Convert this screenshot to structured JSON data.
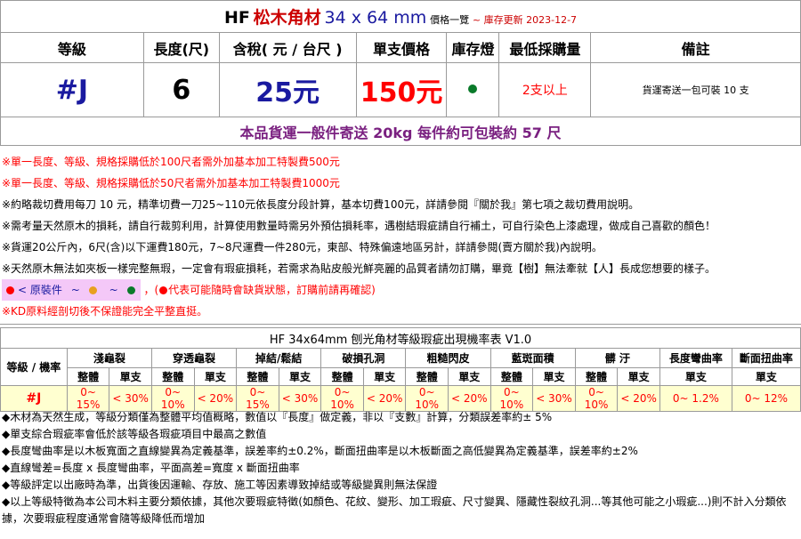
{
  "title": {
    "brand": "HF",
    "material": "松木角材",
    "size": "34 x 64 mm",
    "subtitle": "價格一覽",
    "date_note": "~ 庫存更新 2023-12-7"
  },
  "headers": [
    "等級",
    "長度(尺)",
    "含稅( 元 / 台尺 )",
    "單支價格",
    "庫存燈",
    "最低採購量",
    "備註"
  ],
  "product": {
    "grade": "#J",
    "length": "6",
    "price_per_tai_chi": "25元",
    "unit_price": "150元",
    "stock_light_color": "#0a7a2a",
    "min_order": "2支以上",
    "remark": "貨運寄送一包可裝 10 支"
  },
  "shipping_banner": "本品貨運一般件寄送 20kg 每件約可包裝約 57 尺",
  "notes": {
    "n1": "※單一長度、等級、規格採購低於100尺者需外加基本加工特製費500元",
    "n2": "※單一長度、等級、規格採購低於50尺者需外加基本加工特製費1000元",
    "n3": "※約略裁切費用每刀 10 元，精準切費一刀25~110元依長度分段計算，基本切費100元，詳請參閱『關於我』第七項之裁切費用說明。",
    "n4": "※需考量天然原木的損耗，請自行裁剪利用，計算使用數量時需另外預估損耗率，遇樹結瑕疵請自行補土，可自行染色上漆處理，做成自己喜歡的顏色！",
    "n5": "※貨運20公斤內，6尺(含)以下運費180元，7~8尺運費一件280元，東部、特殊偏遠地區另計，詳請參閱(賣方關於我)內說明。",
    "n6": "※天然原木無法如夾板一樣完整無瑕，一定會有瑕疵損耗，若需求為貼皮般光鮮亮麗的品質者請勿訂購，畢竟【樹】無法牽就【人】長成您想要的樣子。",
    "stock_label": "< 原裝件",
    "stock_colors": [
      "#ff0000",
      "#e8a020",
      "#0a7a2a"
    ],
    "stock_tilde": "~",
    "red_note_open": "，(",
    "red_note": "代表可能隨時會缺貨狀態，訂購前請再確認)",
    "n8": "※KD原料經剖切後不保證能完全平整直挺。"
  },
  "defect_table": {
    "caption": "HF 34x64mm 刨光角材等級瑕疵出現機率表 V1.0",
    "row_header": "等級 / 機率",
    "categories": [
      "淺龜裂",
      "穿透龜裂",
      "掉結/鬆結",
      "破損孔洞",
      "粗糙閃皮",
      "藍斑面積",
      "髒 汙",
      "長度彎曲率",
      "斷面扭曲率"
    ],
    "sub_whole": "整體",
    "sub_single": "單支",
    "row": {
      "grade": "#J",
      "values": [
        "0~ 15%",
        "< 30%",
        "0~ 10%",
        "< 20%",
        "0~ 15%",
        "< 30%",
        "0~ 10%",
        "< 20%",
        "0~ 10%",
        "< 20%",
        "0~ 10%",
        "< 30%",
        "0~ 10%",
        "< 20%",
        "0~ 1.2%",
        "0~ 12%"
      ]
    }
  },
  "footnotes": [
    "◆木材為天然生成，等級分類僅為整體平均值概略，數值以『長度』做定義，非以『支數』計算，分類誤差率約± 5%",
    "◆單支綜合瑕疵率會低於該等級各瑕疵項目中最高之數值",
    "◆長度彎曲率是以木板寬面之直線變異為定義基準，誤差率約±0.2%，斷面扭曲率是以木板斷面之高低變異為定義基準，誤差率約±2%",
    "◆直線彎差=長度 x 長度彎曲率，平面高差=寬度 x 斷面扭曲率",
    "◆等級評定以出廠時為準，出貨後因運輸、存放、施工等因素導致掉結或等級變異則無法保證",
    "◆以上等級特徵為本公司木料主要分類依據，其他次要瑕疵特徵(如顏色、花紋、變形、加工瑕疵、尺寸變異、隱藏性裂紋孔洞...等其他可能之小瑕疵...)則不計入分類依據，次要瑕疵程度通常會隨等級降低而增加"
  ]
}
